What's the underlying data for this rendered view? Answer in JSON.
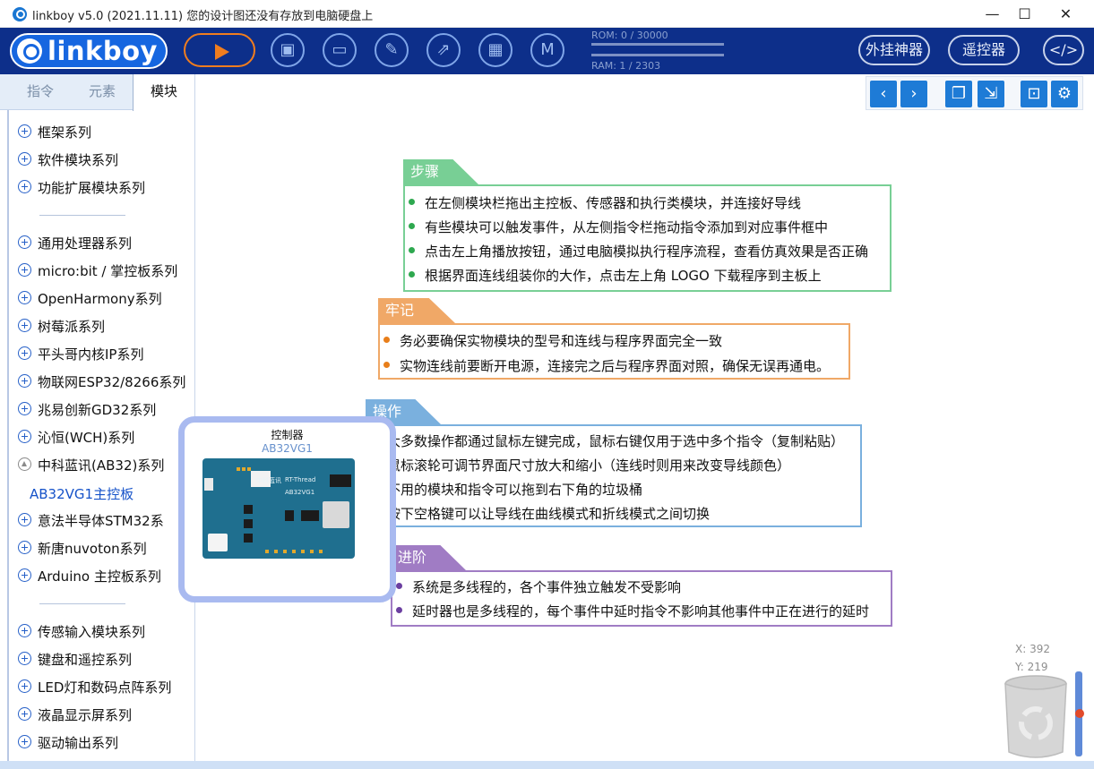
{
  "window": {
    "title": "linkboy v5.0 (2021.11.11) 您的设计图还没有存放到电脑硬盘上",
    "controls": [
      "—",
      "☐",
      "✕"
    ]
  },
  "toolbar": {
    "brand": "linkboy",
    "rom": "ROM: 0 / 30000",
    "ram": "RAM: 1 / 2303",
    "plugin_button": "外挂神器",
    "remote_button": "遥控器",
    "code_button": "</>",
    "icons": [
      "play-icon",
      "save-icon",
      "folder-icon",
      "edit-icon",
      "export-icon",
      "grid-icon",
      "m-icon"
    ]
  },
  "left_tabs": [
    "指令",
    "元素",
    "模块"
  ],
  "active_tab": "模块",
  "module_groups": [
    "框架系列",
    "软件模块系列",
    "功能扩展模块系列",
    "通用处理器系列",
    "micro:bit / 掌控板系列",
    "OpenHarmony系列",
    "树莓派系列",
    "平头哥内核IP系列",
    "物联网ESP32/8266系列",
    "兆易创新GD32系列",
    "沁恒(WCH)系列",
    "中科蓝讯(AB32)系列",
    "意法半导体STM32系",
    "新唐nuvoton系列",
    "Arduino 主控板系列",
    "传感输入模块系列",
    "键盘和遥控系列",
    "LED灯和数码点阵系列",
    "液晶显示屏系列",
    "驱动输出系列"
  ],
  "selected_module": "AB32VG1主控板",
  "popup": {
    "title": "控制器",
    "subtitle": "AB32VG1",
    "board_text_1": "中科蓝讯",
    "board_text_2": "RT-Thread",
    "board_text_3": "AB32VG1"
  },
  "steps": {
    "title": "步骤",
    "color": "#78cf95",
    "items": [
      "在左侧模块栏拖出主控板、传感器和执行类模块，并连接好导线",
      "有些模块可以触发事件，从左侧指令栏拖动指令添加到对应事件框中",
      "点击左上角播放按钮，通过电脑模拟执行程序流程，查看仿真效果是否正确",
      "根据界面连线组装你的大作，点击左上角 LOGO 下载程序到主板上"
    ]
  },
  "remember": {
    "title": "牢记",
    "color": "#f0a867",
    "items": [
      "务必要确保实物模块的型号和连线与程序界面完全一致",
      "实物连线前要断开电源，连接完之后与程序界面对照，确保无误再通电。"
    ]
  },
  "operation": {
    "title": "操作",
    "color": "#7ab0de",
    "items": [
      "大多数操作都通过鼠标左键完成，鼠标右键仅用于选中多个指令（复制粘贴）",
      "鼠标滚轮可调节界面尺寸放大和缩小（连线时则用来改变导线颜色）",
      "不用的模块和指令可以拖到右下角的垃圾桶",
      "按下空格键可以让导线在曲线模式和折线模式之间切换"
    ]
  },
  "advanced": {
    "title": "进阶",
    "color": "#a07cc4",
    "items": [
      "系统是多线程的，各个事件独立触发不受影响",
      "延时器也是多线程的，每个事件中延时指令不影响其他事件中正在进行的延时"
    ]
  },
  "status": {
    "x": "X: 392",
    "y": "Y: 219"
  }
}
